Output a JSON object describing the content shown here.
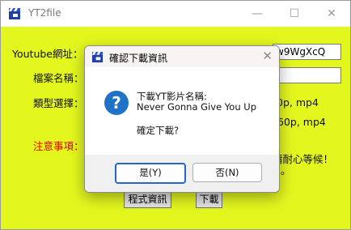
{
  "window": {
    "title": "YT2file",
    "controls": {
      "minimize": "—",
      "maximize": "☐",
      "close": "✕"
    }
  },
  "form": {
    "url_label": "Youtube網址：",
    "url_value_visible": "w9WgXcQ",
    "filename_label": "檔案名稱：",
    "type_label": "類型選擇：",
    "type_option_1_visible": "0p, mp4",
    "type_option_2_visible": "60p, mp4",
    "notes_label": "注意事項：",
    "notes_text_visible": "請耐心等候！",
    "notes_text_line2": "。",
    "info_button": "程式資訊",
    "download_button": "下載"
  },
  "dialog": {
    "title": "確認下載資訊",
    "close": "✕",
    "icon": "question-icon",
    "line1": "下載YT影片名稱:",
    "line2": "Never Gonna Give You Up",
    "line3": "確定下載?",
    "yes_button": "是(Y)",
    "no_button": "否(N)"
  },
  "colors": {
    "background": "#e3f71f",
    "accent": "#2467c9",
    "warning": "#e00000"
  }
}
